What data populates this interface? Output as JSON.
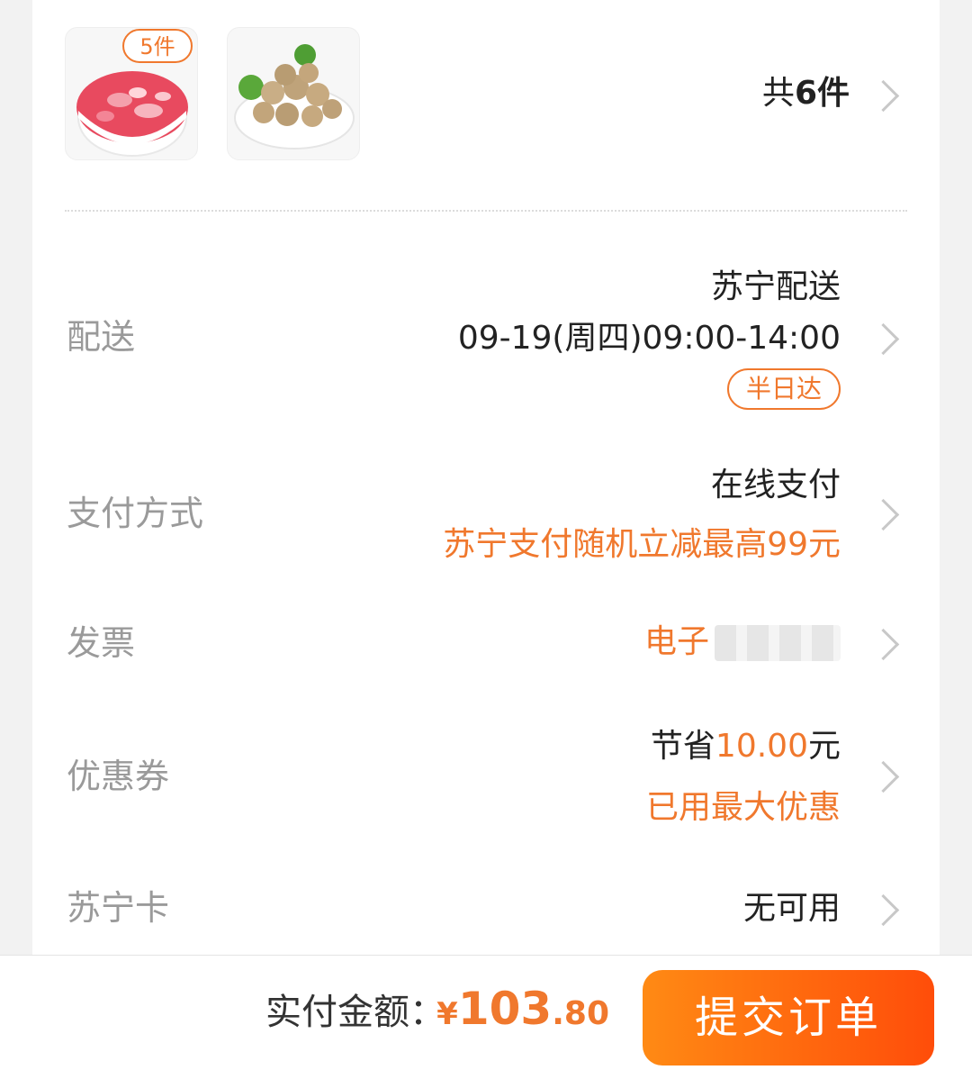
{
  "items": {
    "product_1": {
      "image": "diced-red-ham-in-bowl",
      "qty_badge": "5件"
    },
    "product_2": {
      "image": "meatballs-in-bowl"
    },
    "count_prefix": "共",
    "count_number": "6件"
  },
  "delivery": {
    "label": "配送",
    "carrier": "苏宁配送",
    "time_slot": "09-19(周四)09:00-14:00",
    "badge": "半日达"
  },
  "payment": {
    "label": "支付方式",
    "method": "在线支付",
    "promo": "苏宁支付随机立减最高99元"
  },
  "invoice": {
    "label": "发票",
    "value": "电子"
  },
  "coupon": {
    "label": "优惠券",
    "save_prefix": "节省",
    "save_amount": "10.00",
    "save_suffix": "元",
    "note": "已用最大优惠"
  },
  "card": {
    "label": "苏宁卡",
    "value": "无可用"
  },
  "footer": {
    "total_label": "实付金额：",
    "currency": "¥",
    "total_int": "103",
    "total_dec": ".80",
    "submit_label": "提交订单"
  },
  "colors": {
    "accent": "#f0782d",
    "button_start": "#ff8a14",
    "button_end": "#ff4d0a"
  }
}
